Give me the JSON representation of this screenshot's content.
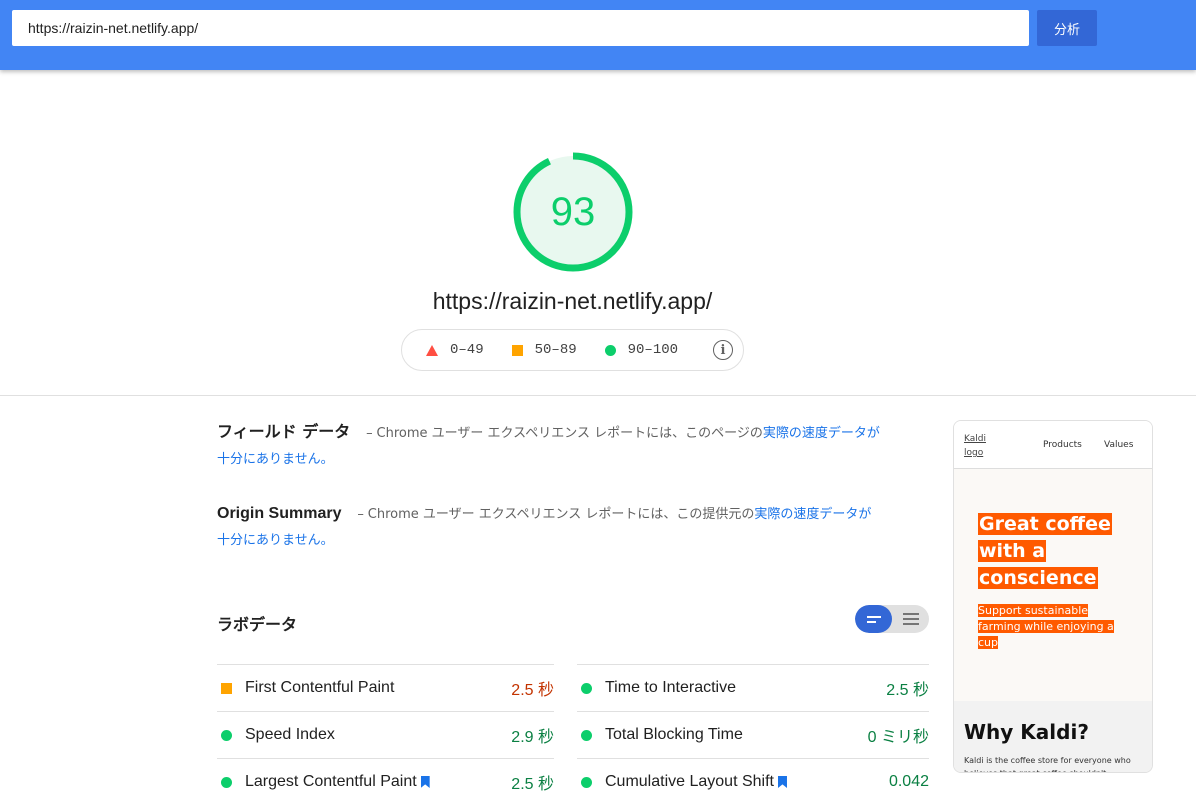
{
  "search": {
    "url_value": "https://raizin-net.netlify.app/",
    "analyze_label": "分析"
  },
  "score": {
    "value": "93",
    "value_fraction": 0.93,
    "tested_url": "https://raizin-net.netlify.app/",
    "color": "#0cce6b"
  },
  "legend": {
    "items": [
      {
        "range": "0–49",
        "icon": "triangle-icon",
        "color": "#ff4e42"
      },
      {
        "range": "50–89",
        "icon": "square-icon",
        "color": "#ffa400"
      },
      {
        "range": "90–100",
        "icon": "circle-icon",
        "color": "#0cce6b"
      }
    ],
    "info_icon": "info-icon"
  },
  "field_data": {
    "title": "フィールド データ",
    "dash": "–",
    "desc_prefix": "Chrome ユーザー エクスペリエンス レポートには、このページの",
    "link_text": "実際の速度データが十分にありません。"
  },
  "origin_summary": {
    "title": "Origin Summary",
    "dash": "–",
    "desc_prefix": "Chrome ユーザー エクスペリエンス レポートには、この提供元の",
    "link_text": "実際の速度データが十分にありません。"
  },
  "lab_data": {
    "title": "ラボデータ",
    "view_toggle": {
      "selected": "summary-view",
      "other": "list-view"
    }
  },
  "metrics": {
    "left": [
      {
        "name": "First Contentful Paint",
        "value": "2.5 秒",
        "status": "average",
        "bookmark": false
      },
      {
        "name": "Speed Index",
        "value": "2.9 秒",
        "status": "pass",
        "bookmark": false
      },
      {
        "name": "Largest Contentful Paint",
        "value": "2.5 秒",
        "status": "pass",
        "bookmark": true
      }
    ],
    "right": [
      {
        "name": "Time to Interactive",
        "value": "2.5 秒",
        "status": "pass",
        "bookmark": false
      },
      {
        "name": "Total Blocking Time",
        "value": "0 ミリ秒",
        "status": "pass",
        "bookmark": false
      },
      {
        "name": "Cumulative Layout Shift",
        "value": "0.042",
        "status": "pass",
        "bookmark": true
      }
    ]
  },
  "screenshot": {
    "logo_alt": "Kaldi logo",
    "nav_products": "Products",
    "nav_values": "Values",
    "hero_lines": [
      "Great coffee",
      "with a",
      "conscience"
    ],
    "sub_lines": [
      "Support sustainable",
      "farming while enjoying a",
      "cup"
    ],
    "why_title": "Why Kaldi?",
    "why_desc": "Kaldi is the coffee store for everyone who believes that great coffee shouldn't"
  }
}
